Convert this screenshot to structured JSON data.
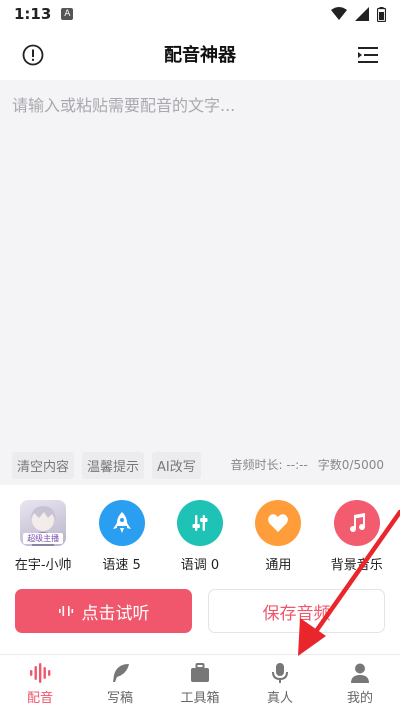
{
  "status_bar": {
    "time": "1:13",
    "notification_glyph": "A"
  },
  "header": {
    "title": "配音神器"
  },
  "editor": {
    "placeholder": "请输入或粘贴需要配音的文字...",
    "value": "",
    "tools": [
      "清空内容",
      "温馨提示",
      "AI改写"
    ],
    "duration_label": "音频时长: --:--",
    "char_count_label": "字数0/5000"
  },
  "features": [
    {
      "label": "在宇-小帅",
      "icon": "voice-avatar",
      "badge": "超级主播"
    },
    {
      "label": "语速 5",
      "icon": "rocket-icon",
      "color": "#2a9ff2"
    },
    {
      "label": "语调 0",
      "icon": "sliders-icon",
      "color": "#1ec3b5"
    },
    {
      "label": "通用",
      "icon": "heart-icon",
      "color": "#ff9d3b"
    },
    {
      "label": "背景音乐",
      "icon": "music-note-icon",
      "color": "#f25c6e"
    }
  ],
  "actions": {
    "preview_label": "点击试听",
    "save_label": "保存音频"
  },
  "tabs": [
    {
      "label": "配音",
      "icon": "waveform-icon",
      "active": true
    },
    {
      "label": "写稿",
      "icon": "feather-icon",
      "active": false
    },
    {
      "label": "工具箱",
      "icon": "briefcase-icon",
      "active": false
    },
    {
      "label": "真人",
      "icon": "microphone-icon",
      "active": false
    },
    {
      "label": "我的",
      "icon": "person-icon",
      "active": false
    }
  ],
  "colors": {
    "accent": "#f0566c",
    "editor_bg": "#f4f4f6",
    "annotation_arrow": "#e8262c"
  }
}
